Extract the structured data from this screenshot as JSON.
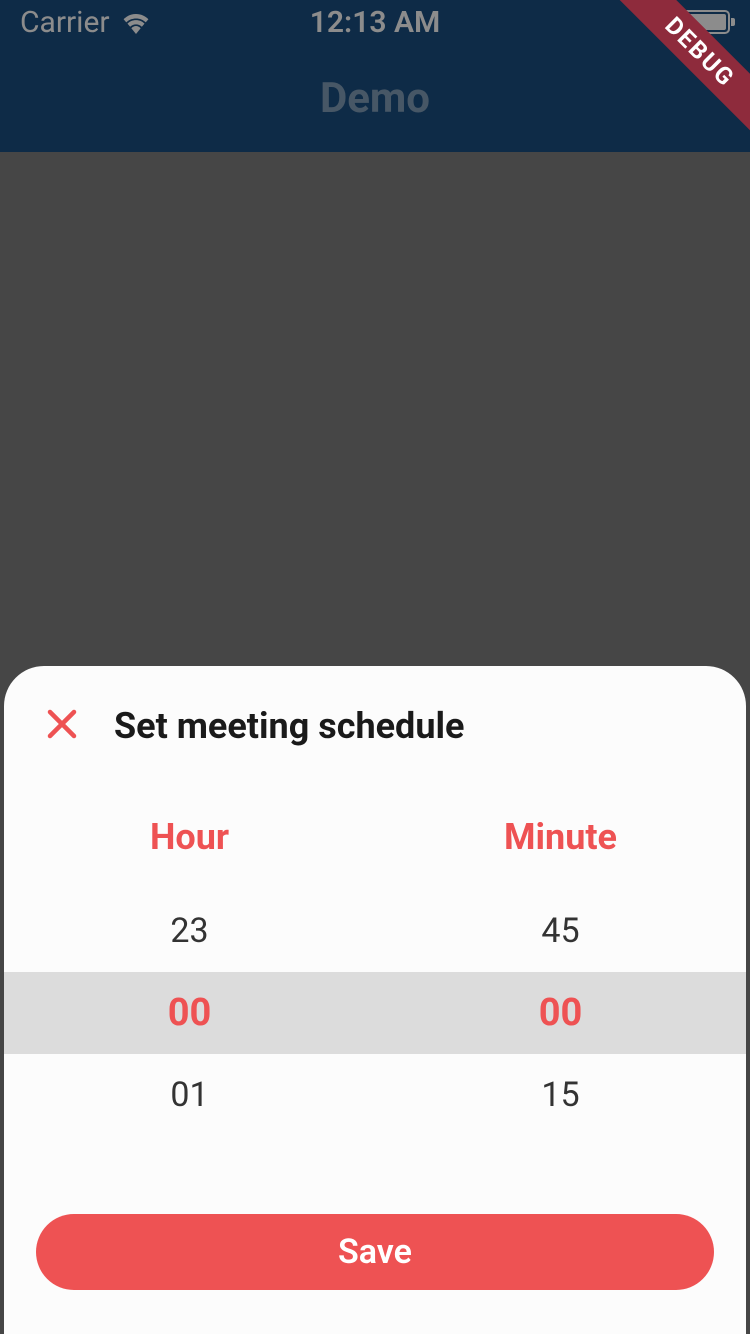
{
  "status": {
    "carrier": "Carrier",
    "time": "12:13 AM"
  },
  "app": {
    "title": "Demo"
  },
  "debug_banner": "DEBUG",
  "sheet": {
    "title": "Set meeting schedule",
    "hour_label": "Hour",
    "minute_label": "Minute",
    "hour_prev": "23",
    "hour_selected": "00",
    "hour_next": "01",
    "minute_prev": "45",
    "minute_selected": "00",
    "minute_next": "15",
    "save_label": "Save"
  },
  "colors": {
    "appbar": "#1b4f81",
    "accent": "#ee5253",
    "debug": "#8e2b3c"
  }
}
